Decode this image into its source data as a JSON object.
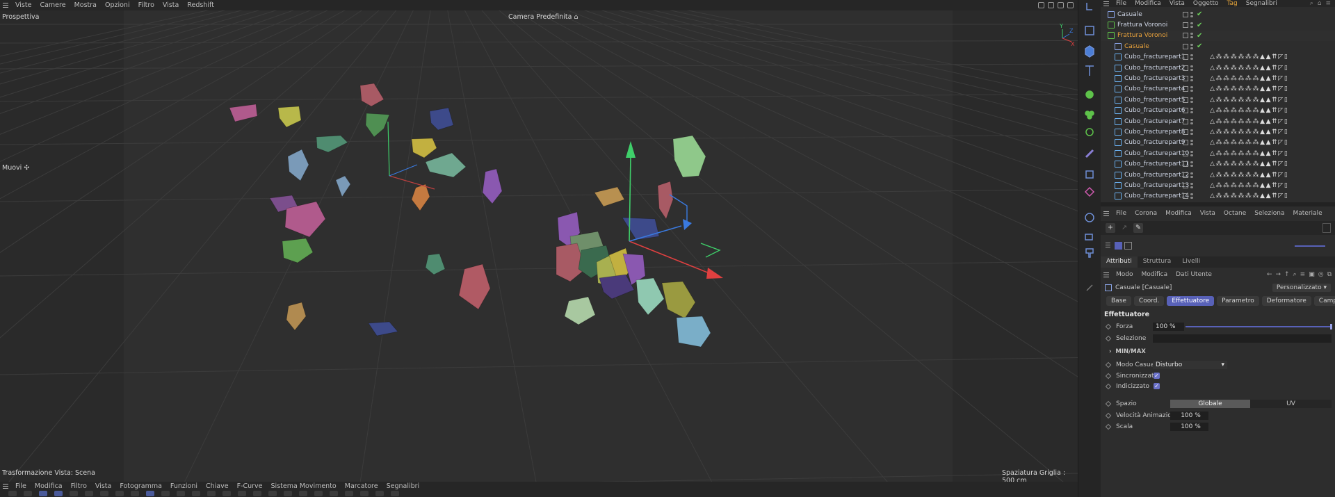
{
  "viewport": {
    "menu": [
      "Viste",
      "Camere",
      "Mostra",
      "Opzioni",
      "Filtro",
      "Vista",
      "Redshift"
    ],
    "view_name": "Prospettiva",
    "camera": "Camera Predefinita",
    "tool": "Muovi",
    "transform_info": "Trasformazione Vista: Scena",
    "grid_spacing": "Spaziatura Griglia : 500 cm",
    "axis_labels": {
      "y": "Y",
      "z": "Z",
      "x": "X"
    }
  },
  "timeline": {
    "menu": [
      "File",
      "Modifica",
      "Filtro",
      "Vista",
      "Fotogramma",
      "Funzioni",
      "Chiave",
      "F-Curve",
      "Sistema Movimento",
      "Marcatore",
      "Segnalibri"
    ]
  },
  "object_manager": {
    "menu": [
      "File",
      "Modifica",
      "Vista",
      "Oggetto",
      "Tag",
      "Segnalibri"
    ],
    "objects": [
      {
        "name": "Casuale",
        "indent": 0,
        "icon": "effector-icon",
        "orange": false,
        "check": true,
        "tags": false
      },
      {
        "name": "Frattura Voronoi",
        "indent": 0,
        "icon": "voronoi-icon",
        "orange": false,
        "check": true,
        "tags": false
      },
      {
        "name": "Frattura Voronoi",
        "indent": 0,
        "icon": "voronoi-icon",
        "orange": true,
        "check": true,
        "tags": false
      },
      {
        "name": "Casuale",
        "indent": 1,
        "icon": "effector-icon",
        "orange": true,
        "check": true,
        "tags": false
      },
      {
        "name": "Cubo_fracturepart1",
        "indent": 1,
        "icon": "polygon-icon",
        "orange": false,
        "check": false,
        "tags": true
      },
      {
        "name": "Cubo_fracturepart2",
        "indent": 1,
        "icon": "polygon-icon",
        "orange": false,
        "check": false,
        "tags": true
      },
      {
        "name": "Cubo_fracturepart3",
        "indent": 1,
        "icon": "polygon-icon",
        "orange": false,
        "check": false,
        "tags": true
      },
      {
        "name": "Cubo_fracturepart4",
        "indent": 1,
        "icon": "polygon-icon",
        "orange": false,
        "check": false,
        "tags": true
      },
      {
        "name": "Cubo_fracturepart5",
        "indent": 1,
        "icon": "polygon-icon",
        "orange": false,
        "check": false,
        "tags": true
      },
      {
        "name": "Cubo_fracturepart6",
        "indent": 1,
        "icon": "polygon-icon",
        "orange": false,
        "check": false,
        "tags": true
      },
      {
        "name": "Cubo_fracturepart7",
        "indent": 1,
        "icon": "polygon-icon",
        "orange": false,
        "check": false,
        "tags": true
      },
      {
        "name": "Cubo_fracturepart8",
        "indent": 1,
        "icon": "polygon-icon",
        "orange": false,
        "check": false,
        "tags": true
      },
      {
        "name": "Cubo_fracturepart9",
        "indent": 1,
        "icon": "polygon-icon",
        "orange": false,
        "check": false,
        "tags": true
      },
      {
        "name": "Cubo_fracturepart10",
        "indent": 1,
        "icon": "polygon-icon",
        "orange": false,
        "check": false,
        "tags": true
      },
      {
        "name": "Cubo_fracturepart11",
        "indent": 1,
        "icon": "polygon-icon",
        "orange": false,
        "check": false,
        "tags": true
      },
      {
        "name": "Cubo_fracturepart12",
        "indent": 1,
        "icon": "polygon-icon",
        "orange": false,
        "check": false,
        "tags": true
      },
      {
        "name": "Cubo_fracturepart13",
        "indent": 1,
        "icon": "polygon-icon",
        "orange": false,
        "check": false,
        "tags": true
      },
      {
        "name": "Cubo_fracturepart14",
        "indent": 1,
        "icon": "polygon-icon",
        "orange": false,
        "check": false,
        "tags": true
      }
    ],
    "tag_glyphs": "△⁂⁂⁂⁂⁂⁂▲▲⇈◸▯"
  },
  "material_manager": {
    "menu": [
      "File",
      "Corona",
      "Modifica",
      "Vista",
      "Octane",
      "Seleziona",
      "Materiale"
    ]
  },
  "attributes": {
    "tabs": [
      "Attributi",
      "Struttura",
      "Livelli"
    ],
    "menu": [
      "Modo",
      "Modifica",
      "Dati Utente"
    ],
    "object_title": "Casuale [Casuale]",
    "preset": "Personalizzato",
    "param_tabs": [
      "Base",
      "Coord.",
      "Effettuatore",
      "Parametro",
      "Deformatore",
      "Campi"
    ],
    "active_tab": "Effettuatore",
    "section": "Effettuatore",
    "forza_label": "Forza",
    "forza_value": "100 %",
    "forza_fraction": 1.0,
    "selezione_label": "Selezione",
    "minmax_label": "MIN/MAX",
    "modo_label": "Modo Casuale",
    "modo_value": "Disturbo",
    "sincronizzato_label": "Sincronizzato",
    "sincronizzato": true,
    "indicizzato_label": "Indicizzato",
    "indicizzato": true,
    "spazio_label": "Spazio",
    "spazio_options": [
      "Globale",
      "UV"
    ],
    "velocita_label": "Velocità Animazione",
    "velocita_value": "100 %",
    "scala_label": "Scala",
    "scala_value": "100 %"
  },
  "colors": {
    "accent": "#5861b8",
    "orange": "#e8a23c",
    "check_green": "#6ccf5b",
    "axis_y": "#3fcf6a",
    "axis_x": "#e04040",
    "axis_z": "#3a7ae0"
  }
}
